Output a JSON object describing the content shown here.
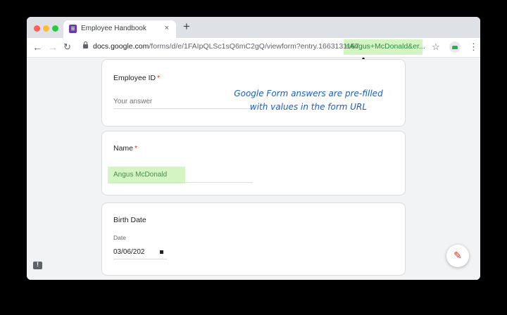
{
  "browser": {
    "tab_title": "Employee Handbook",
    "tab_close": "×",
    "new_tab": "+",
    "url_host": "docs.google.com",
    "url_path": "/forms/d/e/1FAIpQLSc1sQ6mC2gQ/viewform?entry.1663131167",
    "url_highlight": "=Angus+McDonald&er...",
    "back_icon": "arrow-left-icon",
    "forward_icon": "arrow-right-icon",
    "reload_icon": "reload-icon",
    "star_icon": "star-icon"
  },
  "form": {
    "q1_label": "Employee ID",
    "q1_required": "*",
    "q1_placeholder": "Your answer",
    "q2_label": "Name",
    "q2_required": "*",
    "q2_value": "Angus McDonald",
    "q3_label": "Birth Date",
    "q3_sub": "Date",
    "q3_value": "03/06/202"
  },
  "annotation": {
    "line1": "Google Form answers are pre-filled",
    "line2": "with values in the form URL"
  },
  "colors": {
    "highlight": "#d4f4c4",
    "form_accent": "#673ab7",
    "annotation": "#1a5fbf",
    "required": "#d93025"
  }
}
